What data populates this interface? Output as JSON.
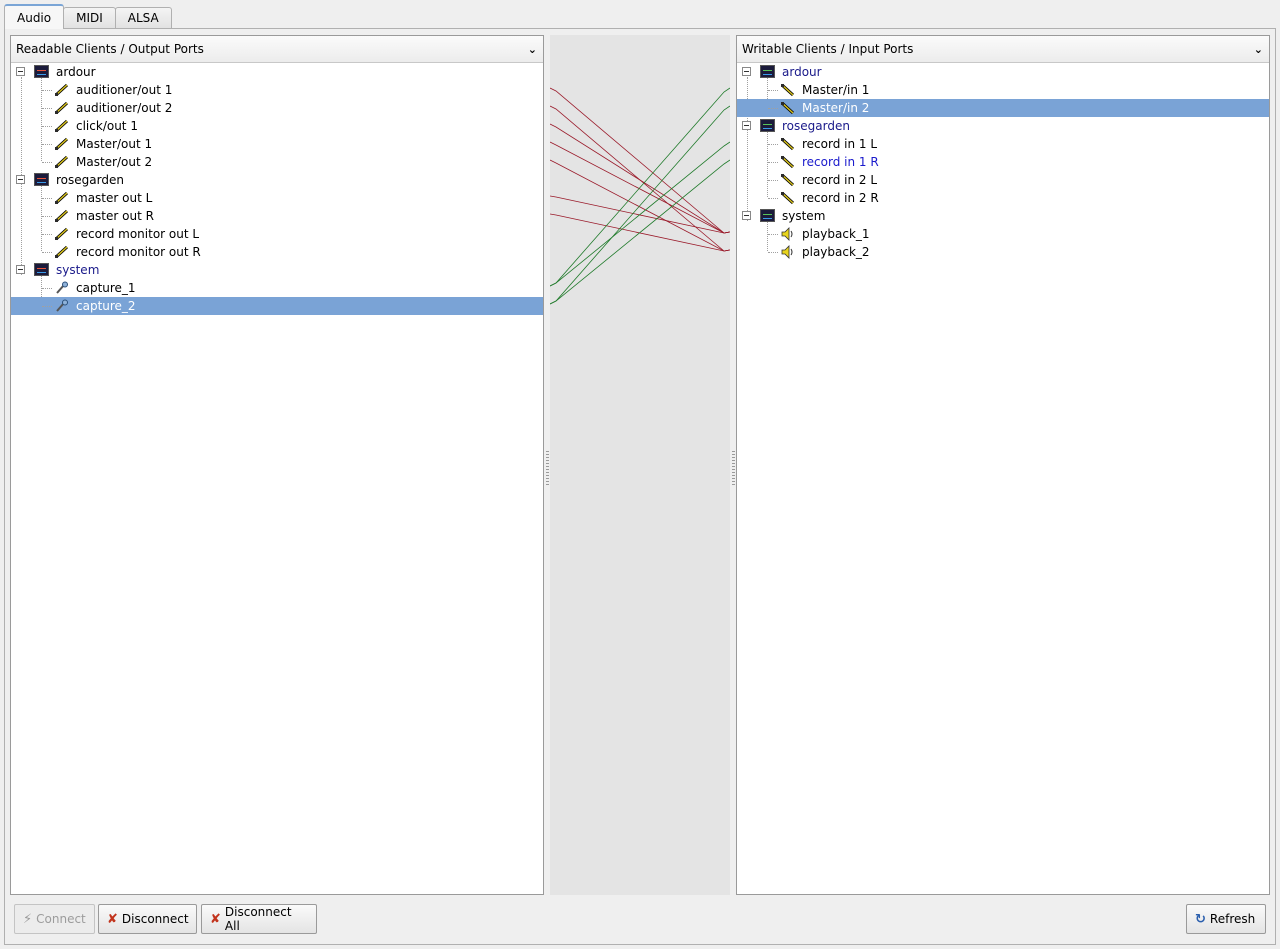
{
  "tabs": [
    {
      "label": "Audio",
      "active": true
    },
    {
      "label": "MIDI",
      "active": false
    },
    {
      "label": "ALSA",
      "active": false
    }
  ],
  "left_panel": {
    "title": "Readable Clients / Output Ports",
    "clients": [
      {
        "name": "ardour",
        "ports": [
          "auditioner/out 1",
          "auditioner/out 2",
          "click/out 1",
          "Master/out 1",
          "Master/out 2"
        ]
      },
      {
        "name": "rosegarden",
        "ports": [
          "master out L",
          "master out R",
          "record monitor out L",
          "record monitor out R"
        ]
      },
      {
        "name": "system",
        "ports": [
          "capture_1",
          "capture_2"
        ]
      }
    ],
    "selected_port": "capture_2"
  },
  "right_panel": {
    "title": "Writable Clients / Input Ports",
    "clients": [
      {
        "name": "ardour",
        "ports": [
          "Master/in 1",
          "Master/in 2"
        ]
      },
      {
        "name": "rosegarden",
        "ports": [
          "record in 1 L",
          "record in 1 R",
          "record in 2 L",
          "record in 2 R"
        ]
      },
      {
        "name": "system",
        "ports": [
          "playback_1",
          "playback_2"
        ]
      }
    ],
    "selected_port": "Master/in 2"
  },
  "buttons": {
    "connect": "Connect",
    "disconnect": "Disconnect",
    "disconnect_all": "Disconnect All",
    "refresh": "Refresh"
  },
  "colors": {
    "selection": "#7aa3d6",
    "output_connection": "#9a1a2a",
    "input_connection": "#1f7a2a"
  }
}
